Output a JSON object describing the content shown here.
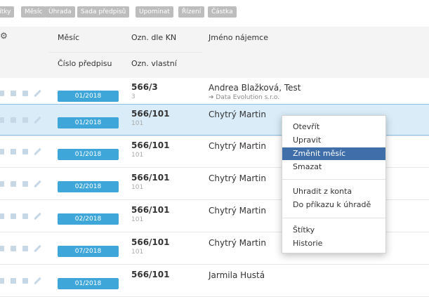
{
  "toolbar": {
    "buttons": [
      "štítky",
      "Měsíc",
      "Úhrada",
      "Sada předpisů",
      "Upominat",
      "Řízení",
      "Částka"
    ]
  },
  "columns": {
    "month": "Měsíc",
    "kn": "Ozn. dle KN",
    "tenant": "Jméno nájemce",
    "prescription": "Číslo předpisu",
    "own": "Ozn. vlastní"
  },
  "rows": [
    {
      "month": "01/2018",
      "kn": "566/3",
      "own": "3",
      "name": "Andrea Blažková, Test",
      "sub": "➔ Data Evolution s.r.o."
    },
    {
      "month": "01/2018",
      "kn": "566/101",
      "own": "101",
      "name": "Chytrý Martin",
      "sub": ""
    },
    {
      "month": "01/2018",
      "kn": "566/101",
      "own": "101",
      "name": "Chytrý Martin",
      "sub": ""
    },
    {
      "month": "02/2018",
      "kn": "566/101",
      "own": "101",
      "name": "Chytrý Martin",
      "sub": ""
    },
    {
      "month": "02/2018",
      "kn": "566/101",
      "own": "101",
      "name": "Chytrý Martin",
      "sub": ""
    },
    {
      "month": "07/2018",
      "kn": "566/101",
      "own": "101",
      "name": "Chytrý Martin",
      "sub": ""
    },
    {
      "month": "01/2018",
      "kn": "566/101",
      "own": "",
      "name": "Jarmila Hustá",
      "sub": ""
    }
  ],
  "context_menu": {
    "items": [
      "Otevřít",
      "Upravit",
      "Změnit měsíc",
      "Smazat",
      "Uhradit z konta",
      "Do příkazu k úhradě",
      "Štítky",
      "Historie"
    ],
    "active": "Změnit měsíc"
  },
  "colors": {
    "month_badge": "#3ea6d9",
    "menu_highlight": "#3f6ea8",
    "selected_row": "#d9ecf8"
  }
}
